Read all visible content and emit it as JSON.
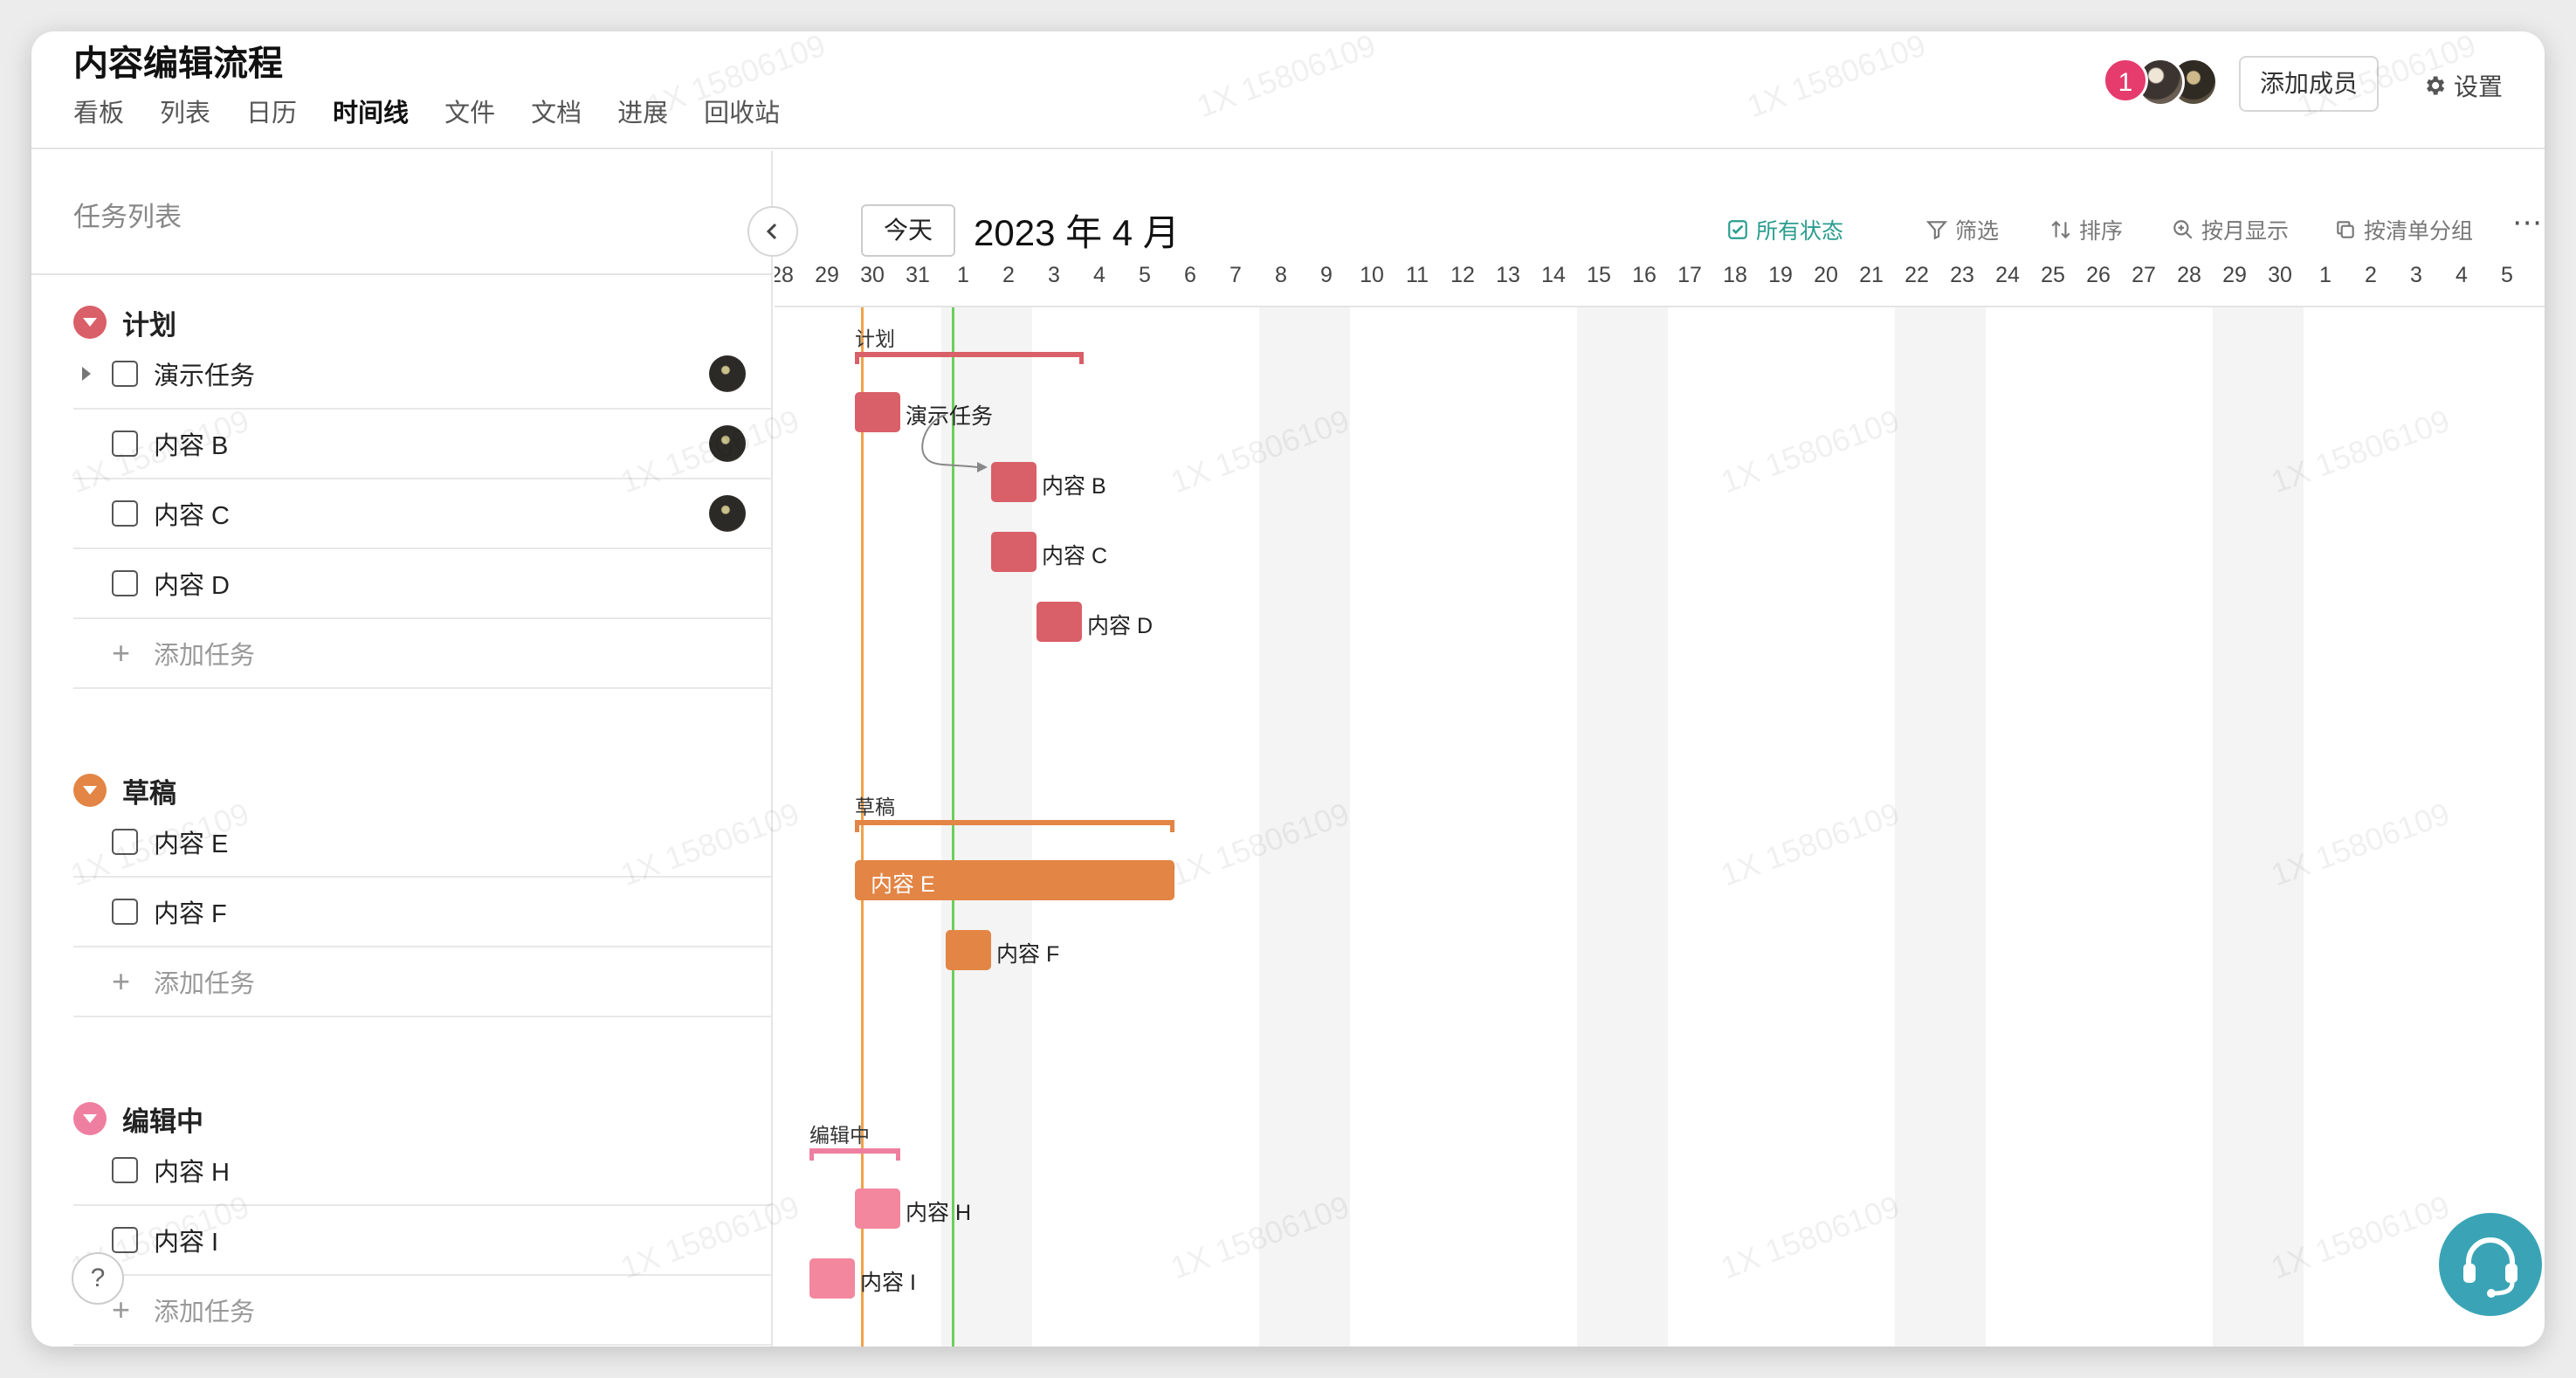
{
  "app": {
    "title": "内容编辑流程"
  },
  "nav": [
    "看板",
    "列表",
    "日历",
    "时间线",
    "文件",
    "文档",
    "进展",
    "回收站"
  ],
  "nav_active_index": 3,
  "header": {
    "notif_count": "1",
    "add_member": "添加成员",
    "settings": "设置"
  },
  "left": {
    "title": "任务列表",
    "groups": [
      {
        "name": "计划",
        "color": "#d95f68",
        "tasks": [
          "演示任务",
          "内容 B",
          "内容 C",
          "内容 D"
        ],
        "add": "添加任务"
      },
      {
        "name": "草稿",
        "color": "#e38545",
        "tasks": [
          "内容 E",
          "内容 F"
        ],
        "add": "添加任务"
      },
      {
        "name": "编辑中",
        "color": "#ef7fa0",
        "tasks": [
          "内容 H",
          "内容 I"
        ],
        "add": "添加任务"
      }
    ]
  },
  "gantt": {
    "today": "今天",
    "month": "2023 年 4 月",
    "toolbar": {
      "all_status": "所有状态",
      "filter": "筛选",
      "sort": "排序",
      "by_month": "按月显示",
      "by_list": "按清单分组"
    },
    "dates": [
      "28",
      "29",
      "30",
      "31",
      "1",
      "2",
      "3",
      "4",
      "5",
      "6",
      "7",
      "8",
      "9",
      "10",
      "11",
      "12",
      "13",
      "14",
      "15",
      "16",
      "17",
      "18",
      "19",
      "20",
      "21",
      "22",
      "23",
      "24",
      "25",
      "26",
      "27",
      "28",
      "29",
      "30",
      "1",
      "2",
      "3",
      "4",
      "5"
    ],
    "bars": {
      "plan": "计划",
      "draft": "草稿",
      "editing": "编辑中",
      "t1": "演示任务",
      "t2": "内容 B",
      "t3": "内容 C",
      "t4": "内容 D",
      "t5": "内容 E",
      "t6": "内容 F",
      "t7": "内容 H",
      "t8": "内容 I"
    }
  },
  "watermark": "1X 15806109",
  "colors": {
    "plan": "#d95f68",
    "draft": "#e38545",
    "editing": "#ef7fa0",
    "today_line": "#f0a24a",
    "green_line": "#6ccf5a",
    "accent": "#2a9d8f"
  }
}
